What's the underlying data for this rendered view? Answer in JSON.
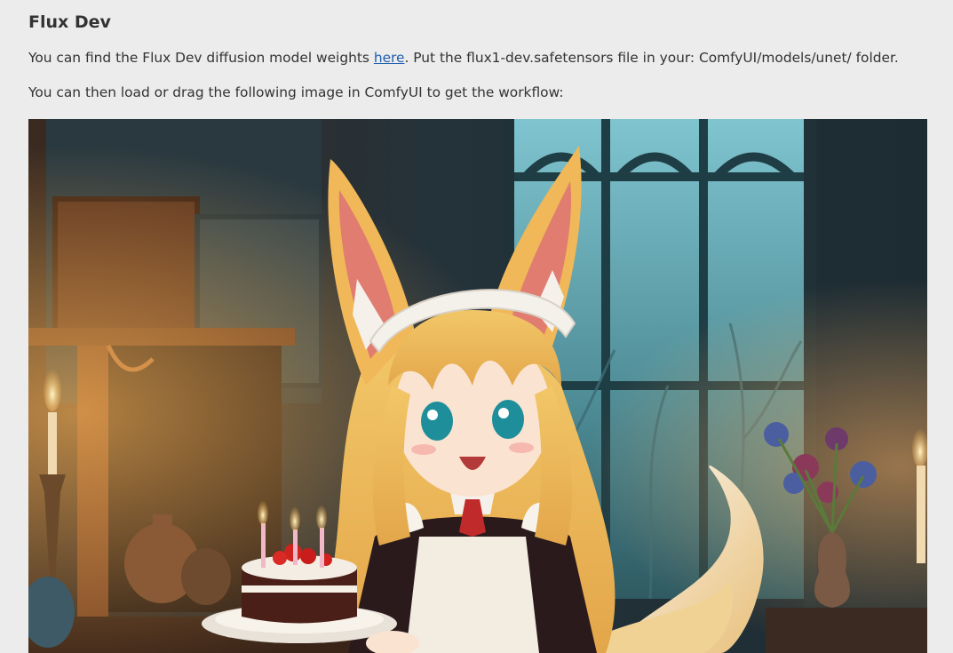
{
  "heading": "Flux Dev",
  "paragraph1": {
    "before": "You can find the Flux Dev diffusion model weights ",
    "link": "here",
    "after": ". Put the flux1-dev.safetensors file in your: ComfyUI/models/unet/ folder."
  },
  "paragraph2": "You can then load or drag the following image in ComfyUI to get the workflow:",
  "image": {
    "subject": "anime fox-eared maid girl holding a chocolate birthday cake with three candles",
    "link_color": "#1f5fb0"
  }
}
